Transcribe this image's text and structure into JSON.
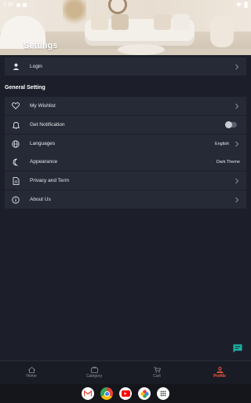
{
  "status_bar": {
    "time": "1:37",
    "wifi_icon": "wifi-icon",
    "battery_icon": "battery-icon"
  },
  "header": {
    "title": "Settings"
  },
  "account": {
    "login_label": "Login",
    "icon": "person-icon"
  },
  "general": {
    "title": "General Setting",
    "items": [
      {
        "label": "My Wishlist",
        "icon": "heart-icon"
      },
      {
        "label": "Get Notification",
        "icon": "bell-icon",
        "toggle_on": false
      },
      {
        "label": "Languages",
        "icon": "globe-icon",
        "value": "English"
      },
      {
        "label": "Appearance",
        "icon": "moon-icon",
        "value": "Dark Theme"
      },
      {
        "label": "Privacy and Term",
        "icon": "document-icon"
      },
      {
        "label": "About Us",
        "icon": "info-icon"
      }
    ]
  },
  "bottom_nav": {
    "items": [
      {
        "label": "Home",
        "icon": "home-icon",
        "active": false
      },
      {
        "label": "Category",
        "icon": "category-icon",
        "active": false
      },
      {
        "label": "Cart",
        "icon": "cart-icon",
        "active": false
      },
      {
        "label": "Profile",
        "icon": "profile-icon",
        "active": true
      }
    ]
  },
  "dock": {
    "apps": [
      "gmail-icon",
      "chrome-icon",
      "youtube-icon",
      "photos-icon",
      "app-drawer-icon"
    ]
  },
  "colors": {
    "background": "#1c1f2a",
    "row": "#262a36",
    "accent": "#ff5a45",
    "fab": "#1fb5a8"
  }
}
